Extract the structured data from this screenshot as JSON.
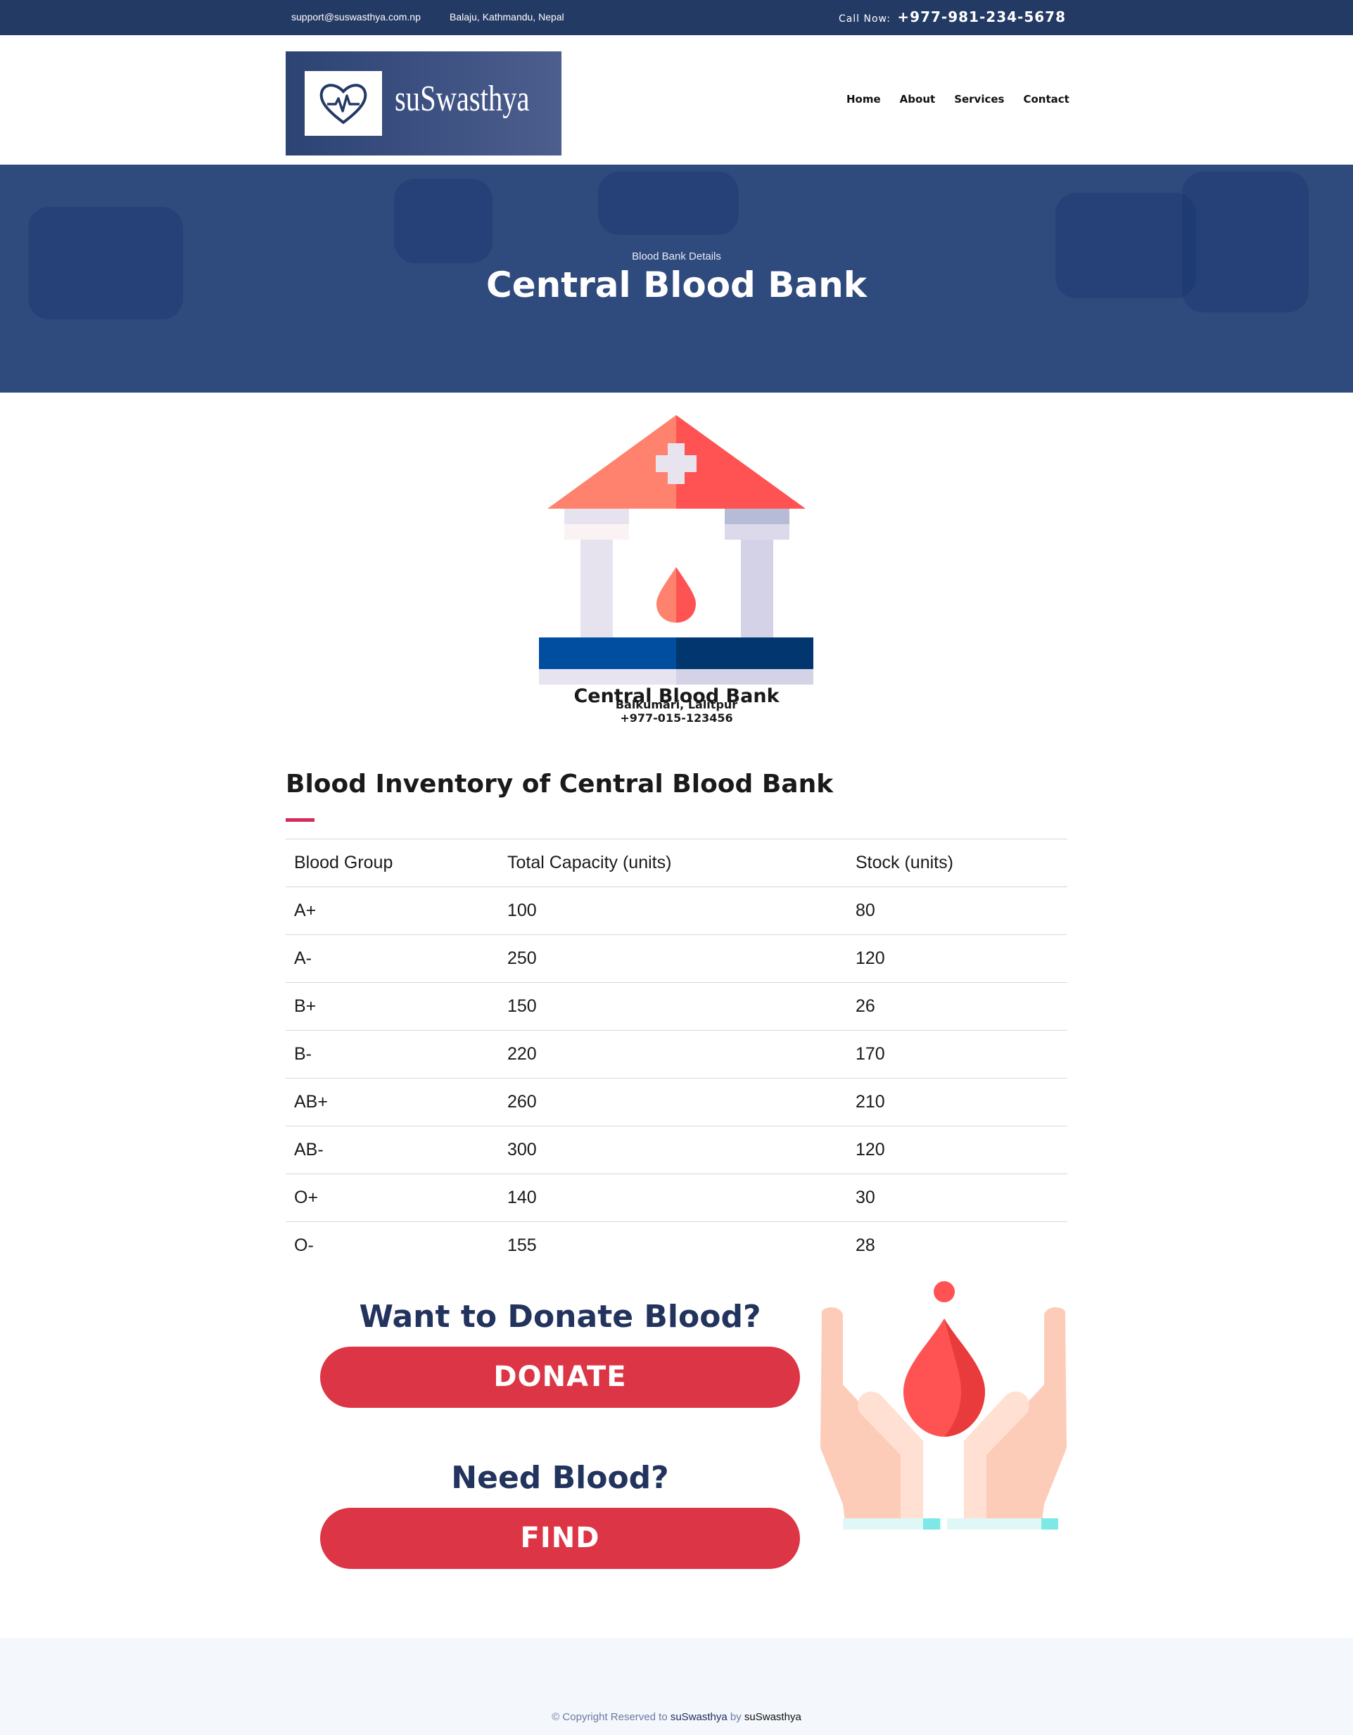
{
  "topbar": {
    "email": "support@suswasthya.com.np",
    "address": "Balaju, Kathmandu, Nepal",
    "call_label": "Call Now:",
    "phone": "+977-981-234-5678"
  },
  "header": {
    "logo_text": "suSwasthya",
    "nav": [
      "Home",
      "About",
      "Services",
      "Contact"
    ]
  },
  "hero": {
    "subtitle": "Blood Bank Details",
    "title": "Central Blood Bank"
  },
  "bank": {
    "name": "Central Blood Bank",
    "address": "Balkumari, Lalitpur",
    "phone": "+977-015-123456"
  },
  "inventory": {
    "title": "Blood Inventory of Central Blood Bank",
    "columns": [
      "Blood Group",
      "Total Capacity (units)",
      "Stock (units)"
    ],
    "rows": [
      [
        "A+",
        "100",
        "80"
      ],
      [
        "A-",
        "250",
        "120"
      ],
      [
        "B+",
        "150",
        "26"
      ],
      [
        "B-",
        "220",
        "170"
      ],
      [
        "AB+",
        "260",
        "210"
      ],
      [
        "AB-",
        "300",
        "120"
      ],
      [
        "O+",
        "140",
        "30"
      ],
      [
        "O-",
        "155",
        "28"
      ]
    ]
  },
  "cta": {
    "donate_question": "Want to Donate Blood?",
    "donate_button": "DONATE",
    "need_question": "Need Blood?",
    "need_button": "FIND"
  },
  "footer": {
    "prefix": "© Copyright Reserved to",
    "brand": "suSwasthya",
    "by": "by",
    "author": "suSwasthya"
  },
  "colors": {
    "topbar": "#233a64",
    "hero": "#2f4a7d",
    "accent_red": "#dc3545",
    "heading_navy": "#22335e",
    "underline": "#d6285a"
  }
}
